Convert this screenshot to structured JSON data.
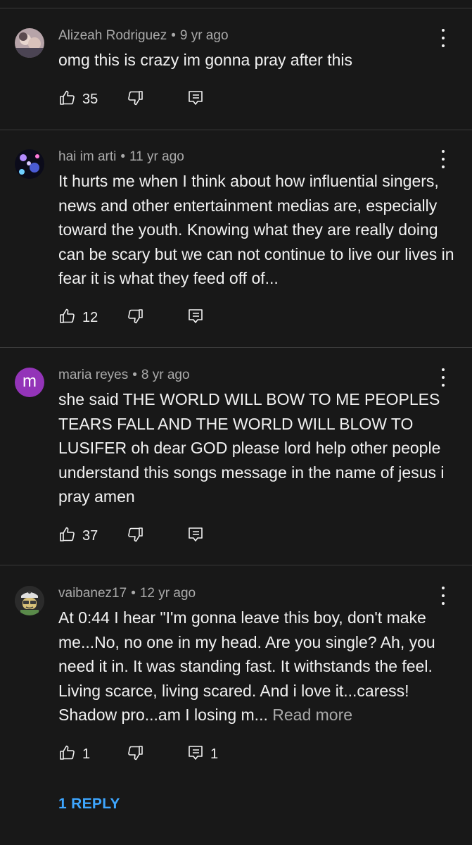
{
  "comments": [
    {
      "author": "Alizeah Rodriguez",
      "time": "9 yr ago",
      "text": "omg this is crazy im gonna pray after this",
      "likes": "35",
      "replies": "",
      "avatar": {
        "kind": "photo",
        "colors": [
          "#8c7a86",
          "#c9b7b9",
          "#4b4453"
        ]
      }
    },
    {
      "author": "hai im arti",
      "time": "11 yr ago",
      "text": "It hurts me when I think about how influential singers, news and other entertainment medias are, especially toward the youth. Knowing what they are really doing can be scary but we can not continue to live our lives in fear it is what they feed off of...",
      "likes": "12",
      "replies": "",
      "avatar": {
        "kind": "photo",
        "colors": [
          "#0b0b1a",
          "#4a5bd4",
          "#d8c8ff"
        ]
      }
    },
    {
      "author": "maria reyes",
      "time": "8 yr ago",
      "text": "she said THE WORLD WILL BOW TO ME PEOPLES TEARS FALL AND THE WORLD WILL BLOW TO LUSIFER oh dear GOD please lord help other people understand this songs message in the name of jesus i pray amen",
      "likes": "37",
      "replies": "",
      "avatar": {
        "kind": "letter",
        "letter": "m",
        "color": "#9334b8"
      }
    },
    {
      "author": "vaibanez17",
      "time": "12 yr ago",
      "text": "At 0:44 I hear \"I'm gonna leave this boy, don't make me...No, no one in my head.  Are you single?  Ah, you need it in.  It was standing fast.  It withstands the feel.  Living scarce, living scared.  And i love it...caress!  Shadow pro...am I losing m...",
      "read_more": "Read more",
      "likes": "1",
      "replies": "1",
      "avatar": {
        "kind": "cartoon",
        "colors": [
          "#d9c27a",
          "#3a3a3a",
          "#e0e0e0"
        ]
      }
    }
  ],
  "reply_link": "1 REPLY",
  "colors": {
    "background": "#181818",
    "text": "#f1f1f1",
    "meta": "#aaaaaa",
    "link": "#3ea6ff",
    "divider": "#3a3a3a"
  },
  "icons": [
    "like-icon",
    "dislike-icon",
    "reply-icon",
    "more-options-icon"
  ]
}
